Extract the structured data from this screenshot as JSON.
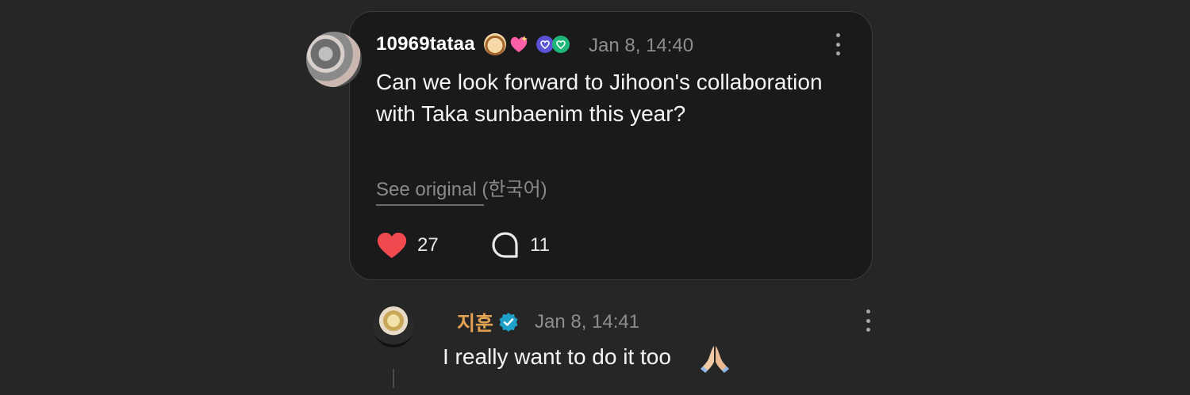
{
  "comment": {
    "username": "10969tataa",
    "timestamp": "Jan 8, 14:40",
    "text": "Can we look forward to Jihoon's collaboration with Taka sunbaenim this year?",
    "see_original": "See original (한국어)",
    "likes": "27",
    "replies": "11",
    "icons": [
      "dog-face-emoji",
      "sparkling-heart-emoji",
      "blue-badge-icon",
      "green-badge-icon",
      "more-icon",
      "heart-icon",
      "comment-icon"
    ]
  },
  "reply": {
    "username": "지훈",
    "timestamp": "Jan 8, 14:41",
    "text": "I really want to do it too",
    "icons": [
      "verified-icon",
      "folded-hands-emoji",
      "more-icon"
    ]
  },
  "colors": {
    "background": "#262626",
    "card": "#1a1a1a",
    "like_heart": "#f04a4f",
    "reply_name": "#e0a252",
    "verified": "#1fa0c8"
  }
}
